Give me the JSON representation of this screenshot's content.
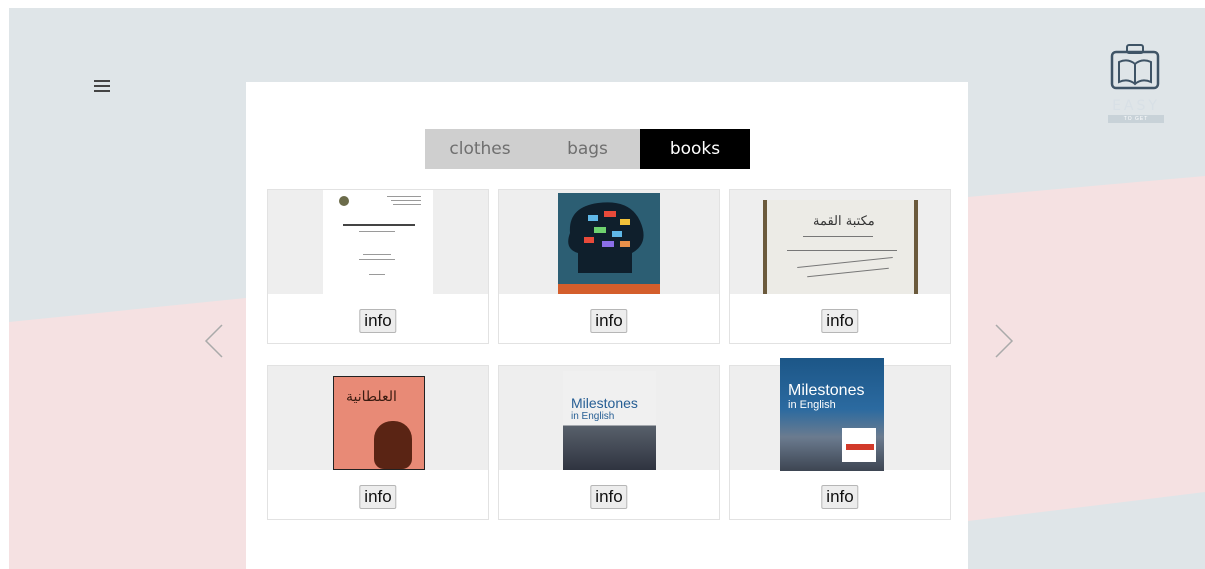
{
  "tabs": [
    {
      "label": "clothes",
      "active": false
    },
    {
      "label": "bags",
      "active": false
    },
    {
      "label": "books",
      "active": true
    }
  ],
  "logo": {
    "text": "EASY",
    "subtext": "TO GET"
  },
  "products": [
    {
      "info_label": "info"
    },
    {
      "info_label": "info"
    },
    {
      "info_label": "info"
    },
    {
      "info_label": "info"
    },
    {
      "info_label": "info"
    },
    {
      "info_label": "info"
    }
  ],
  "book_covers": {
    "notebook_title": "مكتبة القمة",
    "arabic_title": "العلطانية",
    "milestones_title": "Milestones",
    "milestones_sub": "in English"
  },
  "colors": {
    "bg_gray": "#dfe5e8",
    "bg_pink": "#f5e1e2",
    "tab_inactive": "#cfcfcf",
    "tab_active": "#000000"
  }
}
